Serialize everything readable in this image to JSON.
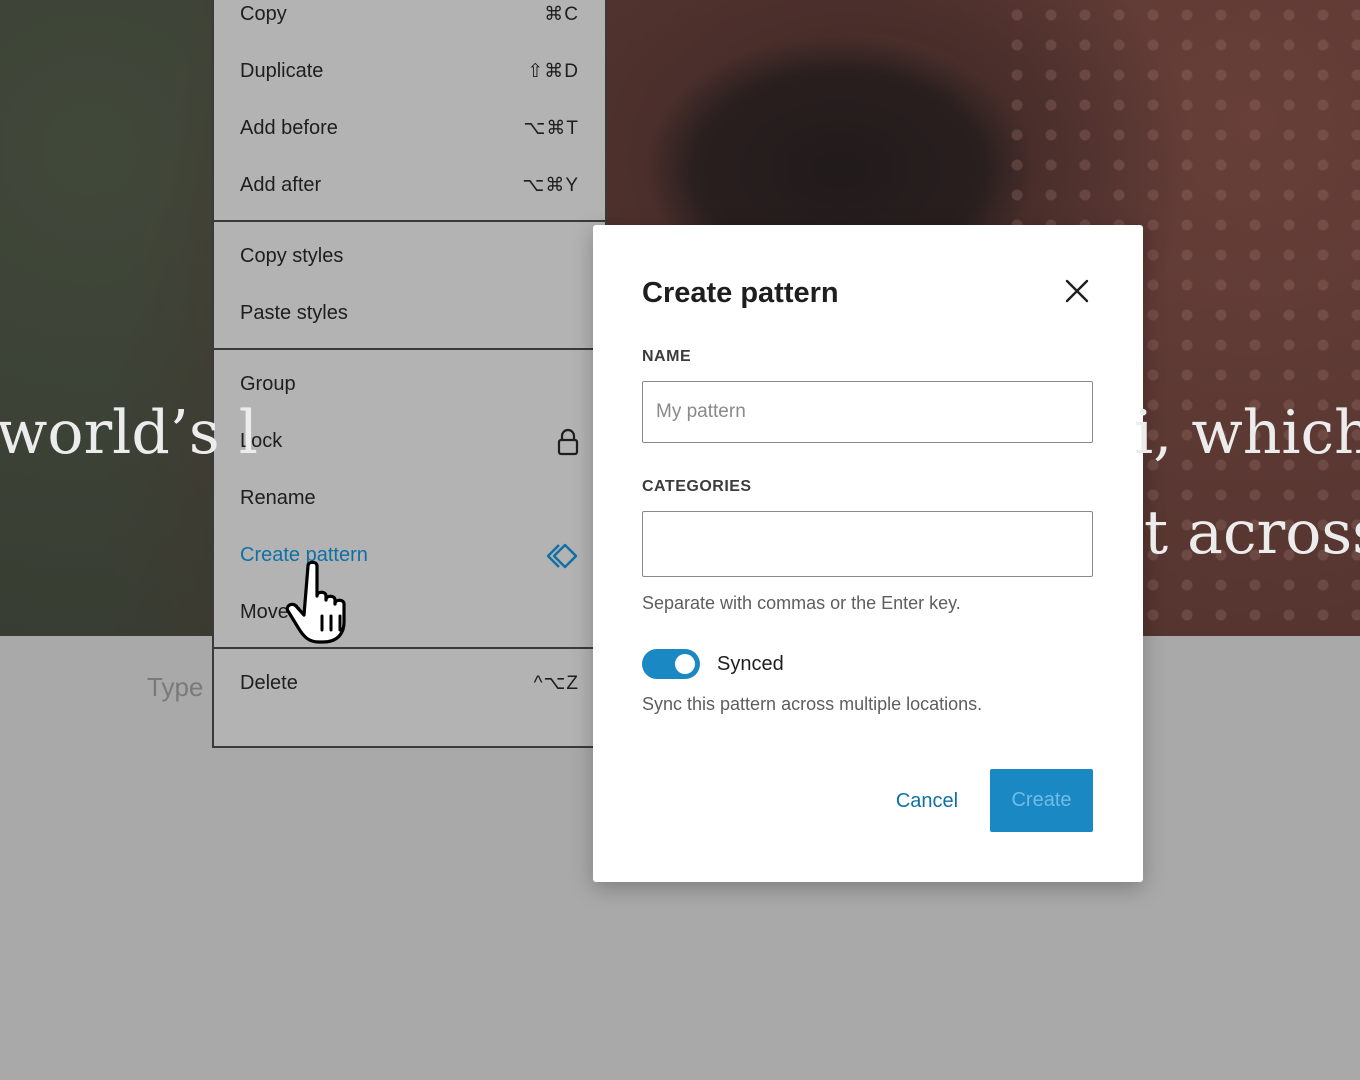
{
  "hero": {
    "text_left": "world’s l",
    "text_right_1": "i, which",
    "text_right_2": "t across."
  },
  "editor": {
    "type_hint": "Type"
  },
  "context_menu": {
    "groups": [
      [
        {
          "label": "Copy",
          "shortcut": "⌘C"
        },
        {
          "label": "Duplicate",
          "shortcut": "⇧⌘D"
        },
        {
          "label": "Add before",
          "shortcut": "⌥⌘T"
        },
        {
          "label": "Add after",
          "shortcut": "⌥⌘Y"
        }
      ],
      [
        {
          "label": "Copy styles"
        },
        {
          "label": "Paste styles"
        }
      ],
      [
        {
          "label": "Group"
        },
        {
          "label": "Lock",
          "icon": "lock-icon"
        },
        {
          "label": "Rename"
        },
        {
          "label": "Create pattern",
          "icon": "pattern-icon",
          "active": true
        },
        {
          "label": "Move t"
        }
      ],
      [
        {
          "label": "Delete",
          "shortcut": "^⌥Z"
        }
      ]
    ]
  },
  "modal": {
    "title": "Create pattern",
    "name_label": "NAME",
    "name_placeholder": "My pattern",
    "name_value": "",
    "categories_label": "CATEGORIES",
    "categories_value": "",
    "categories_help": "Separate with commas or the Enter key.",
    "synced_label": "Synced",
    "synced_on": true,
    "synced_help": "Sync this pattern across multiple locations.",
    "cancel_label": "Cancel",
    "create_label": "Create"
  },
  "colors": {
    "accent": "#1a88c3",
    "link": "#1070a6",
    "overlay": "#a9a9a9"
  }
}
